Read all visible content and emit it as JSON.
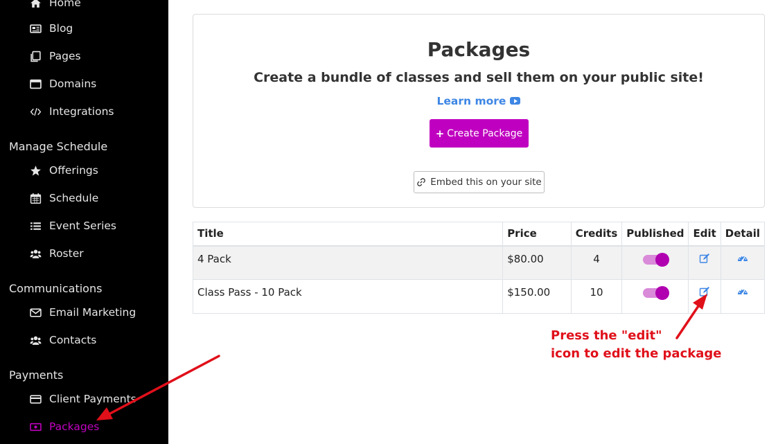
{
  "sidebar": {
    "items": [
      {
        "label": "Home",
        "icon": "home-icon"
      },
      {
        "label": "Blog",
        "icon": "newspaper-icon"
      },
      {
        "label": "Pages",
        "icon": "pages-icon"
      },
      {
        "label": "Domains",
        "icon": "window-icon"
      },
      {
        "label": "Integrations",
        "icon": "code-icon"
      }
    ],
    "sections": [
      {
        "title": "Manage Schedule",
        "items": [
          {
            "label": "Offerings",
            "icon": "star-icon"
          },
          {
            "label": "Schedule",
            "icon": "calendar-icon"
          },
          {
            "label": "Event Series",
            "icon": "list-icon"
          },
          {
            "label": "Roster",
            "icon": "users-icon"
          }
        ]
      },
      {
        "title": "Communications",
        "items": [
          {
            "label": "Email Marketing",
            "icon": "envelope-icon"
          },
          {
            "label": "Contacts",
            "icon": "users-icon"
          }
        ]
      },
      {
        "title": "Payments",
        "items": [
          {
            "label": "Client Payments",
            "icon": "credit-card-icon"
          },
          {
            "label": "Packages",
            "icon": "money-icon",
            "active": true
          }
        ]
      }
    ]
  },
  "header": {
    "title": "Packages",
    "subtitle": "Create a bundle of classes and sell them on your public site!",
    "learn_more": "Learn more",
    "create_label": "Create Package",
    "embed_label": "Embed this on your site"
  },
  "table": {
    "columns": [
      "Title",
      "Price",
      "Credits",
      "Published",
      "Edit",
      "Detail"
    ],
    "rows": [
      {
        "title": "4 Pack",
        "price": "$80.00",
        "credits": "4",
        "published": true
      },
      {
        "title": "Class Pass - 10 Pack",
        "price": "$150.00",
        "credits": "10",
        "published": true
      }
    ]
  },
  "annotation": {
    "line1": "Press the \"edit\"",
    "line2": "icon to edit the package"
  },
  "colors": {
    "accent": "#c000c0",
    "link": "#3d86e4",
    "annotation": "#e0101a",
    "sidebar_bg": "#000000"
  }
}
